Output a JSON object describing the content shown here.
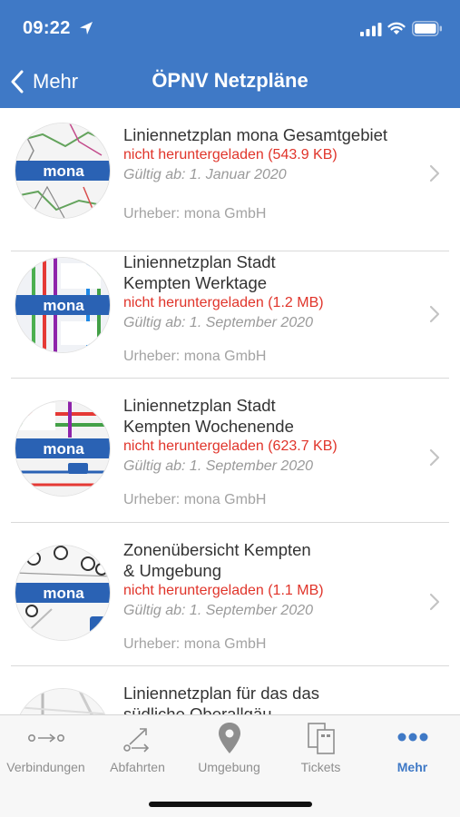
{
  "status_bar": {
    "time": "09:22"
  },
  "nav": {
    "back_label": "Mehr",
    "title": "ÖPNV Netzpläne"
  },
  "colors": {
    "primary": "#3f79c6",
    "status_red": "#e0342a",
    "mona_badge": "#2a62b4"
  },
  "items": [
    {
      "title_lines": [
        "Liniennetzplan mona Gesamtgebiet"
      ],
      "status": "nicht heruntergeladen (543.9 KB)",
      "valid_from": "Gültig ab: 1. Januar 2020",
      "author": "Urheber: mona GmbH",
      "thumb_label": "mona"
    },
    {
      "title_lines": [
        "Liniennetzplan Stadt",
        "Kempten Werktage"
      ],
      "status": "nicht heruntergeladen (1.2 MB)",
      "valid_from": "Gültig ab: 1. September 2020",
      "author": "Urheber: mona GmbH",
      "thumb_label": "mona"
    },
    {
      "title_lines": [
        "Liniennetzplan Stadt",
        "Kempten Wochenende"
      ],
      "status": "nicht heruntergeladen (623.7 KB)",
      "valid_from": "Gültig ab: 1. September 2020",
      "author": "Urheber: mona GmbH",
      "thumb_label": "mona"
    },
    {
      "title_lines": [
        "Zonenübersicht Kempten",
        "& Umgebung"
      ],
      "status": "nicht heruntergeladen (1.1 MB)",
      "valid_from": "Gültig ab: 1. September 2020",
      "author": "Urheber: mona GmbH",
      "thumb_label": "mona"
    },
    {
      "title_lines": [
        "Liniennetzplan für das das",
        "südliche Oberallgäu"
      ]
    }
  ],
  "tabs": [
    {
      "label": "Verbindungen",
      "icon": "connections-icon",
      "active": false
    },
    {
      "label": "Abfahrten",
      "icon": "departures-icon",
      "active": false
    },
    {
      "label": "Umgebung",
      "icon": "location-pin-icon",
      "active": false
    },
    {
      "label": "Tickets",
      "icon": "tickets-icon",
      "active": false
    },
    {
      "label": "Mehr",
      "icon": "more-dots-icon",
      "active": true
    }
  ]
}
